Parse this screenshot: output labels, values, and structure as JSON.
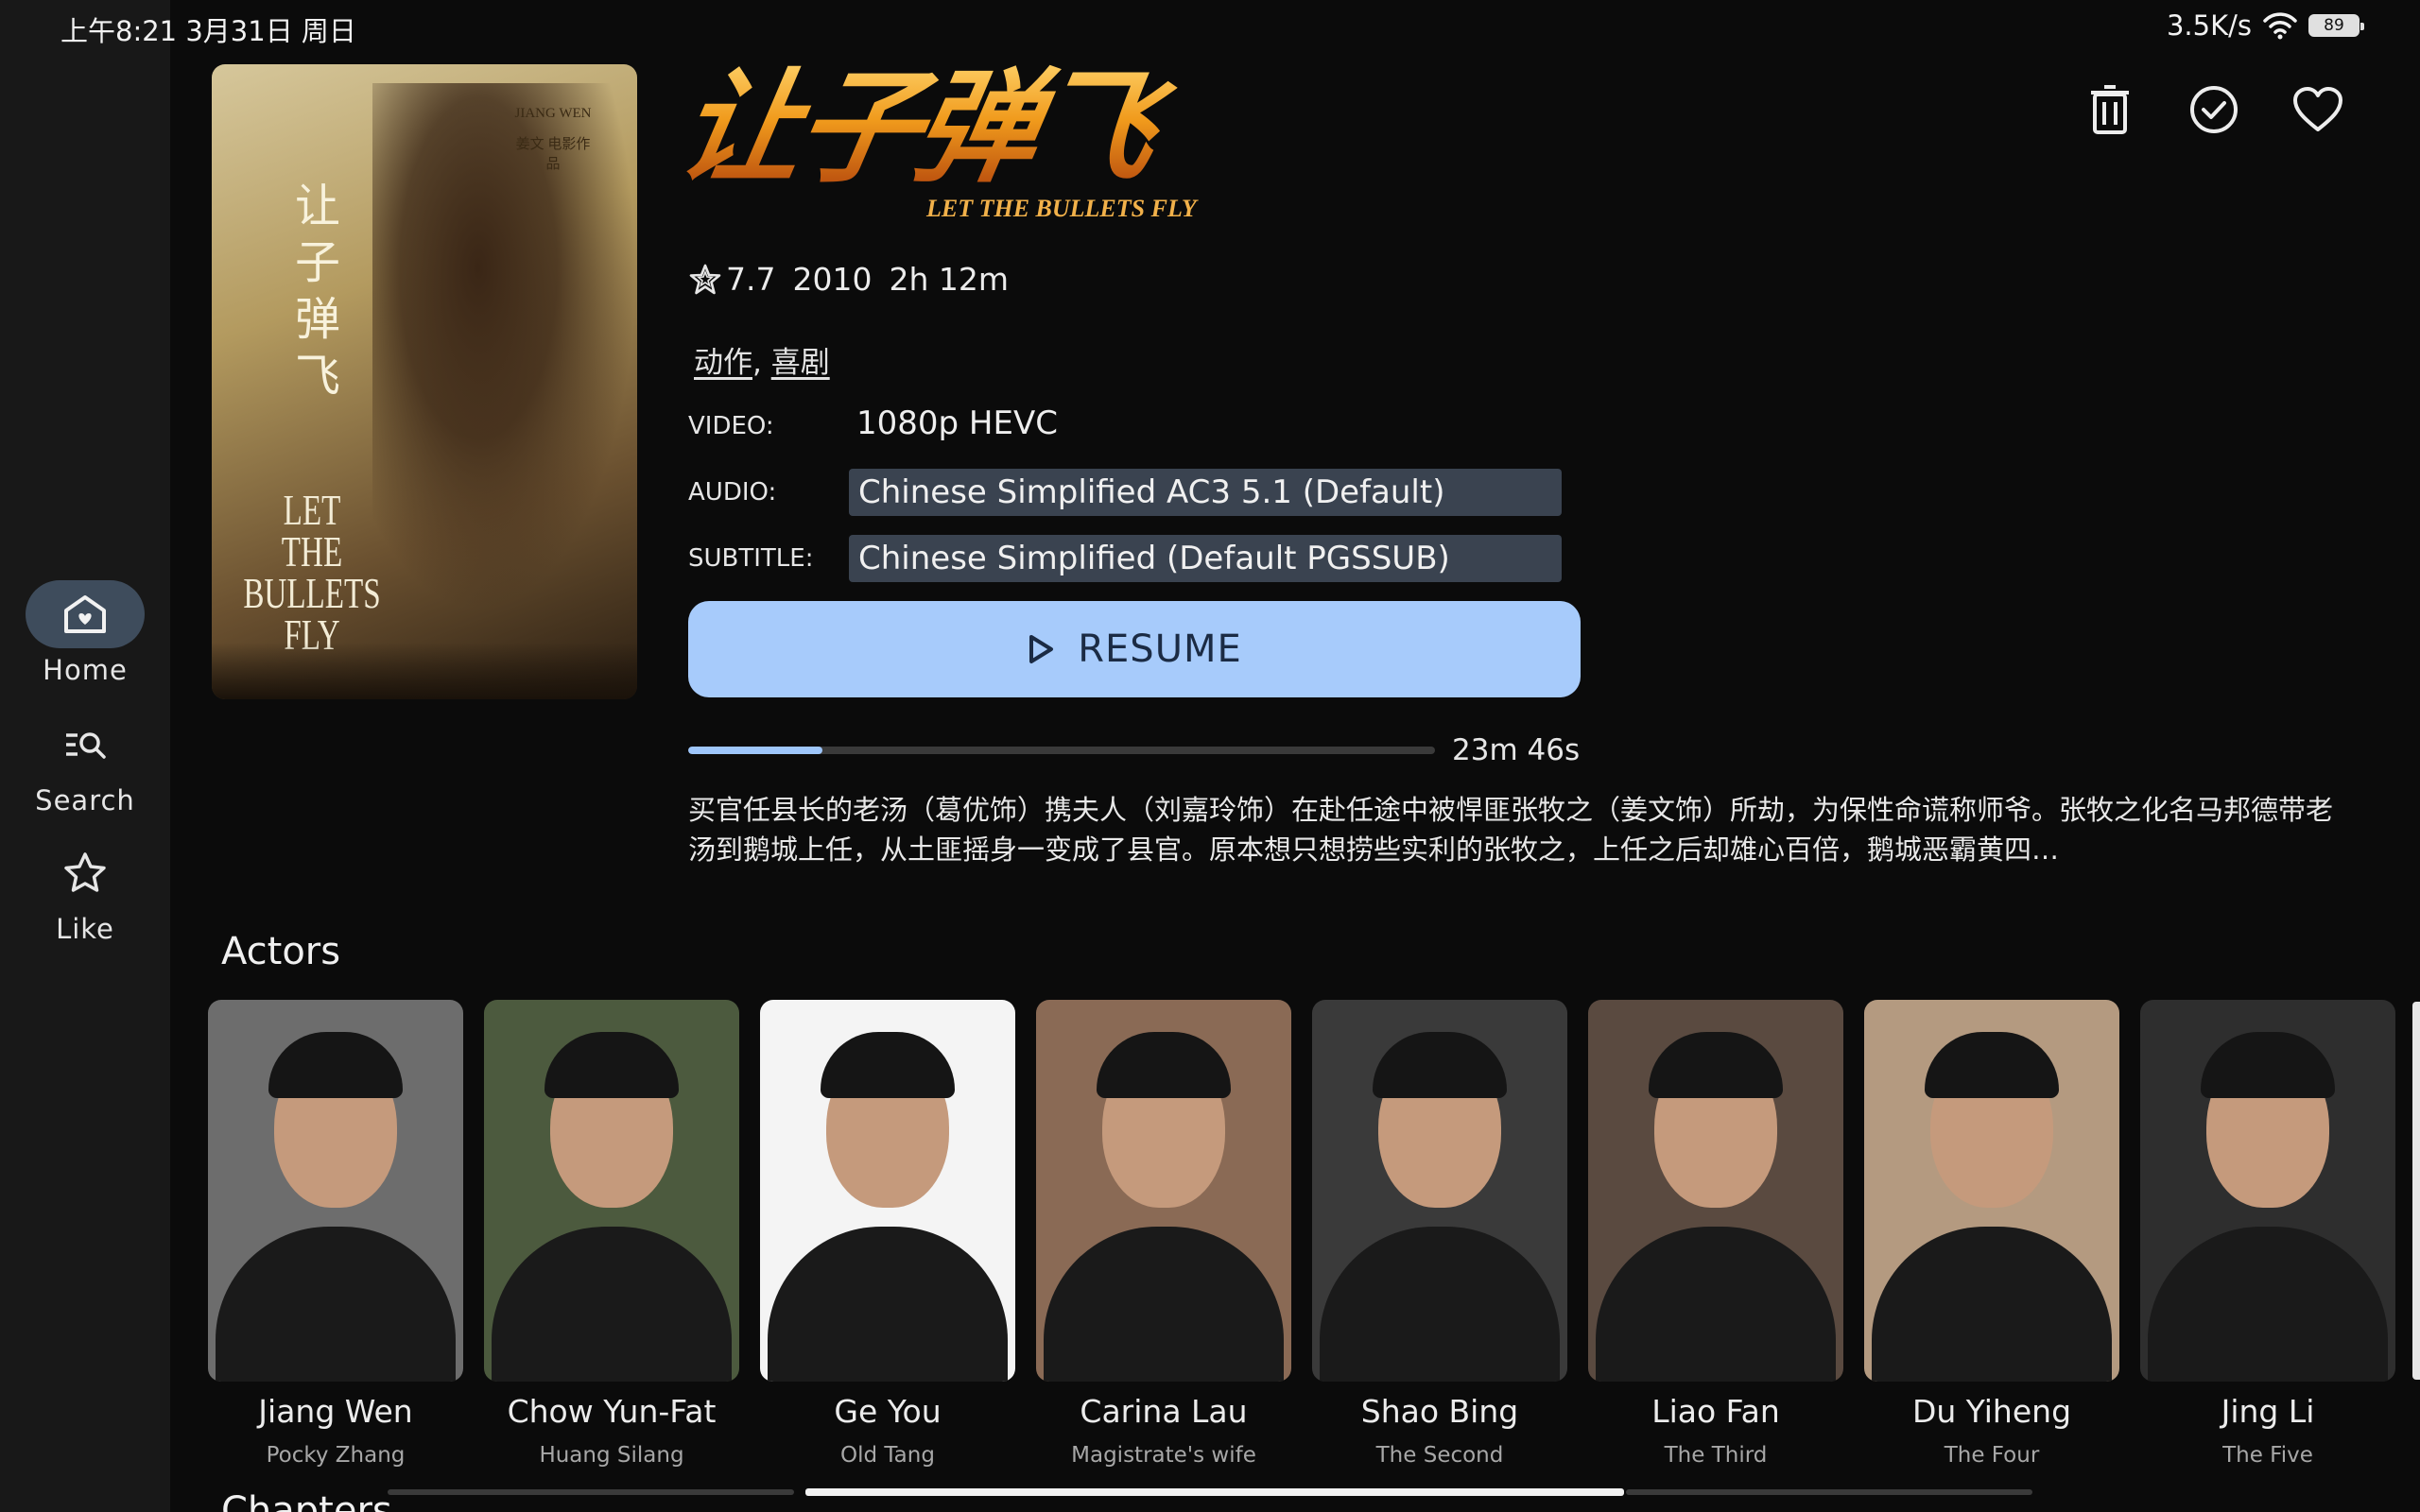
{
  "status_bar": {
    "datetime": "上午8:21 3月31日 周日",
    "network_speed": "3.5K/s",
    "battery": "89"
  },
  "sidebar": {
    "items": [
      {
        "label": "Home",
        "icon": "home-icon",
        "active": true
      },
      {
        "label": "Search",
        "icon": "search-icon",
        "active": false
      },
      {
        "label": "Like",
        "icon": "star-icon",
        "active": false
      }
    ]
  },
  "poster": {
    "director": "JIANG WEN",
    "director_cn": "姜文 电影作品",
    "title_cn": "让子弹飞",
    "title_en": "LET\nTHE BULLETS\nFLY"
  },
  "logo": {
    "title_cn": "让子弹飞",
    "title_en": "LET THE BULLETS FLY"
  },
  "actions": [
    {
      "name": "delete-icon"
    },
    {
      "name": "check-icon"
    },
    {
      "name": "heart-icon"
    }
  ],
  "meta": {
    "rating": "7.7",
    "year": "2010",
    "duration": "2h 12m"
  },
  "genres": [
    "动作",
    "喜剧"
  ],
  "genre_separator": ",",
  "video": {
    "label": "VIDEO:",
    "value": "1080p HEVC"
  },
  "audio": {
    "label": "AUDIO:",
    "value": "Chinese Simplified AC3 5.1 (Default)"
  },
  "subtitle": {
    "label": "SUBTITLE:",
    "value": "Chinese Simplified (Default PGSSUB)"
  },
  "resume_label": "RESUME",
  "progress": {
    "fraction": 0.18,
    "remaining": "23m 46s"
  },
  "overview": "买官任县长的老汤（葛优饰）携夫人（刘嘉玲饰）在赴任途中被悍匪张牧之（姜文饰）所劫，为保性命谎称师爷。张牧之化名马邦德带老汤到鹅城上任，从土匪摇身一变成了县官。原本想只想捞些实利的张牧之，上任之后却雄心百倍，鹅城恶霸黄四…",
  "actors_title": "Actors",
  "actors": [
    {
      "name": "Jiang Wen",
      "role": "Pocky Zhang",
      "bg": "#6d6d6d"
    },
    {
      "name": "Chow Yun-Fat",
      "role": "Huang Silang",
      "bg": "#4c5a3e"
    },
    {
      "name": "Ge You",
      "role": "Old Tang",
      "bg": "#f4f4f4"
    },
    {
      "name": "Carina Lau",
      "role": "Magistrate's wife",
      "bg": "#8a6a55"
    },
    {
      "name": "Shao Bing",
      "role": "The Second",
      "bg": "#3a3a3a"
    },
    {
      "name": "Liao Fan",
      "role": "The Third",
      "bg": "#5a4a40"
    },
    {
      "name": "Du Yiheng",
      "role": "The Four",
      "bg": "#b49a80"
    },
    {
      "name": "Jing Li",
      "role": "The Five",
      "bg": "#2e2e2e"
    }
  ],
  "next_section_title": "Chapters"
}
